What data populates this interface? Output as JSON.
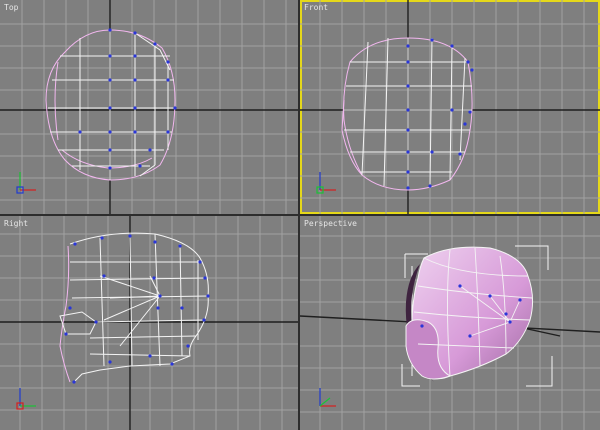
{
  "viewports": [
    {
      "id": "top",
      "label": "Top",
      "active": false
    },
    {
      "id": "front",
      "label": "Front",
      "active": true
    },
    {
      "id": "right",
      "label": "Right",
      "active": false
    },
    {
      "id": "perspective",
      "label": "Perspective",
      "active": false
    }
  ],
  "colors": {
    "grid": "#a2a2a2",
    "axis": "#1f1f1f",
    "wire_pink": "#f2b7ef",
    "wire_white": "#f4f4f4",
    "vertex": "#2a36d8",
    "active_border": "#e5d81a",
    "shade": "#d79ad8",
    "gizmo_x": "#d61f1f",
    "gizmo_y": "#19c236",
    "gizmo_z": "#1f3bd1"
  }
}
